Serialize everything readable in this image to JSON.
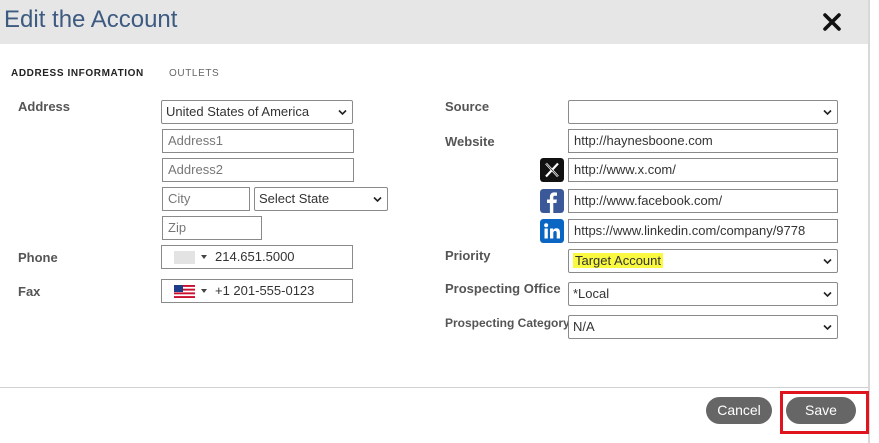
{
  "dialog": {
    "title": "Edit the Account"
  },
  "tabs": [
    {
      "label": "ADDRESS INFORMATION"
    },
    {
      "label": "OUTLETS"
    }
  ],
  "labels": {
    "address": "Address",
    "phone": "Phone",
    "fax": "Fax",
    "source": "Source",
    "website": "Website",
    "priority": "Priority",
    "prospecting_office": "Prospecting Office",
    "prospecting_category": "Prospecting Category"
  },
  "address": {
    "country": "United States of America",
    "address1_placeholder": "Address1",
    "address2_placeholder": "Address2",
    "city_placeholder": "City",
    "state": "Select State",
    "zip_placeholder": "Zip"
  },
  "phone": {
    "value": "214.651.5000"
  },
  "fax": {
    "value": "+1 201-555-0123"
  },
  "source": {
    "value": ""
  },
  "website": {
    "main": "http://haynesboone.com",
    "x": "http://www.x.com/",
    "facebook": "http://www.facebook.com/",
    "linkedin": "https://www.linkedin.com/company/9778"
  },
  "priority": {
    "value": "Target Account",
    "highlight_color": "#f9f941"
  },
  "prospecting_office": {
    "value": "*Local"
  },
  "prospecting_category": {
    "value": "N/A"
  },
  "footer": {
    "cancel_label": "Cancel",
    "save_label": "Save"
  },
  "colors": {
    "title": "#3d5a80",
    "button": "#666666",
    "annotation_red": "#e0141e",
    "facebook": "#3b5998",
    "linkedin": "#0a66c2"
  },
  "icons": [
    "close-icon",
    "x-icon",
    "facebook-icon",
    "linkedin-icon",
    "chevron-down-icon",
    "us-flag-icon"
  ]
}
